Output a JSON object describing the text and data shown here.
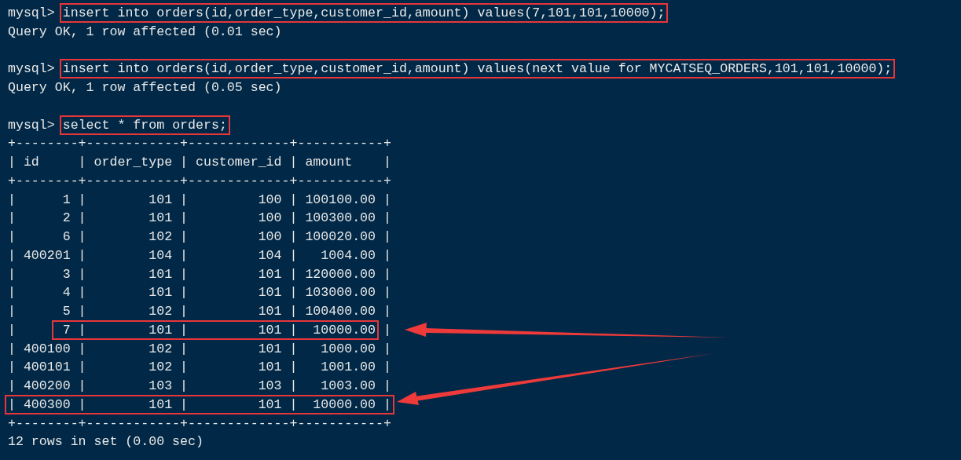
{
  "terminal": {
    "blocks": [
      {
        "lines": [
          {
            "segments": [
              {
                "text": "mysql> ",
                "highlighted": false
              },
              {
                "text": "insert into orders(id,order_type,customer_id,amount) values(7,101,101,10000);",
                "highlighted": true
              }
            ]
          },
          {
            "segments": [
              {
                "text": "Query OK, 1 row affected (0.01 sec)",
                "highlighted": false
              }
            ]
          }
        ]
      },
      {
        "lines": [
          {
            "segments": [
              {
                "text": "mysql> ",
                "highlighted": false
              },
              {
                "text": "insert into orders(id,order_type,customer_id,amount) values(next value for MYCATSEQ_ORDERS,101,101,10000);",
                "highlighted": true
              }
            ]
          },
          {
            "segments": [
              {
                "text": "Query OK, 1 row affected (0.05 sec)",
                "highlighted": false
              }
            ]
          }
        ]
      },
      {
        "lines": [
          {
            "segments": [
              {
                "text": "mysql> ",
                "highlighted": false
              },
              {
                "text": "select * from orders;",
                "highlighted": true
              }
            ]
          },
          {
            "segments": [
              {
                "text": "+--------+------------+-------------+-----------+",
                "highlighted": false
              }
            ]
          },
          {
            "segments": [
              {
                "text": "| id     | order_type | customer_id | amount    |",
                "highlighted": false
              }
            ]
          },
          {
            "segments": [
              {
                "text": "+--------+------------+-------------+-----------+",
                "highlighted": false
              }
            ]
          },
          {
            "segments": [
              {
                "text": "|      1 |        101 |         100 | 100100.00 |",
                "highlighted": false
              }
            ]
          },
          {
            "segments": [
              {
                "text": "|      2 |        101 |         100 | 100300.00 |",
                "highlighted": false
              }
            ]
          },
          {
            "segments": [
              {
                "text": "|      6 |        102 |         100 | 100020.00 |",
                "highlighted": false
              }
            ]
          },
          {
            "segments": [
              {
                "text": "| 400201 |        104 |         104 |   1004.00 |",
                "highlighted": false
              }
            ]
          },
          {
            "segments": [
              {
                "text": "|      3 |        101 |         101 | 120000.00 |",
                "highlighted": false
              }
            ]
          },
          {
            "segments": [
              {
                "text": "|      4 |        101 |         101 | 103000.00 |",
                "highlighted": false
              }
            ]
          },
          {
            "segments": [
              {
                "text": "|      5 |        102 |         101 | 100400.00 |",
                "highlighted": false
              }
            ]
          },
          {
            "segments": [
              {
                "text": "|     ",
                "highlighted": false
              },
              {
                "text": " 7 |        101 |         101 |  10000.00",
                "highlighted": true
              },
              {
                "text": " |",
                "highlighted": false
              }
            ]
          },
          {
            "segments": [
              {
                "text": "| 400100 |        102 |         101 |   1000.00 |",
                "highlighted": false
              }
            ]
          },
          {
            "segments": [
              {
                "text": "| 400101 |        102 |         101 |   1001.00 |",
                "highlighted": false
              }
            ]
          },
          {
            "segments": [
              {
                "text": "| 400200 |        103 |         103 |   1003.00 |",
                "highlighted": false
              }
            ]
          },
          {
            "segments": [
              {
                "text": "| 400300 |        101 |         101 |  10000.00 |",
                "highlighted": true
              }
            ]
          },
          {
            "segments": [
              {
                "text": "+--------+------------+-------------+-----------+",
                "highlighted": false
              }
            ]
          },
          {
            "segments": [
              {
                "text": "12 rows in set (0.00 sec)",
                "highlighted": false
              }
            ]
          }
        ]
      }
    ]
  }
}
